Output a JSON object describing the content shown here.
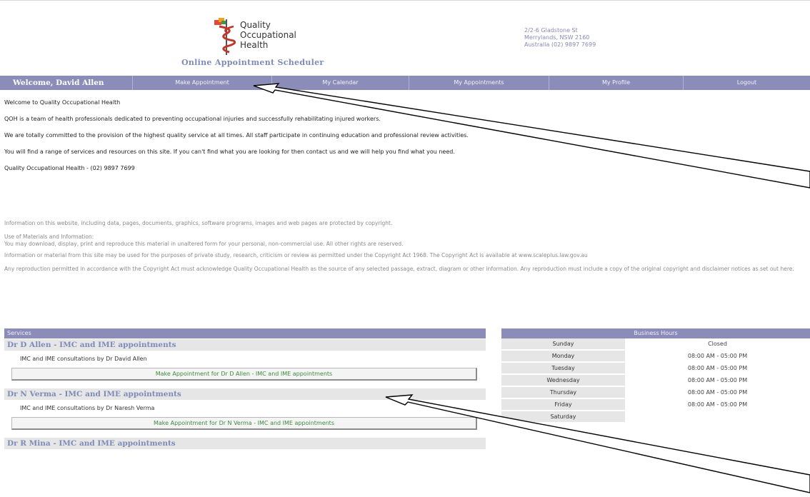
{
  "header": {
    "brand_line1": "Quality",
    "brand_line2": "Occupational",
    "brand_line3": "Health",
    "scheduler_title": "Online Appointment Scheduler",
    "address_line1": "2/2-6 Gladstone St",
    "address_line2": "Merrylands, NSW 2160",
    "address_line3": "Australia  (02) 9897 7699"
  },
  "nav": {
    "welcome": "Welcome, David Allen",
    "items": [
      "Make Appointment",
      "My Calendar",
      "My Appointments",
      "My Profile",
      "Logout"
    ]
  },
  "intro": [
    "Welcome to Quality Occupational Health",
    "QOH is a team of health professionals dedicated to preventing occupational injuries and successfully rehabilitating injured workers.",
    "We are totally committed to the provision of the highest quality service at all times. All staff participate in continuing education and professional review activities.",
    "You will find a range of services and resources on this site. If you can't find what you are looking for then contact us and we will help you find what you need.",
    "Quality Occupational Health - (02) 9897 7699"
  ],
  "legal": [
    "Information on this website, including data, pages, documents, graphics, software programs, images and web pages are protected by copyright.",
    "Use of Materials and Information:",
    "You may download, display, print and reproduce this material in unaltered form for your personal, non-commercial use. All other rights are reserved.",
    "Information or material from this site may be used for the purposes of private study, research, criticism or review as permitted under the Copyright Act 1968. The Copyright Act is available at www.scaleplus.law.gov.au",
    "Any reproduction permitted in accordance with the Copyright Act must acknowledge Quality Occupational Health as the source of any selected passage, extract, diagram or other information. Any reproduction must include a copy of the original copyright and disclaimer notices as set out here."
  ],
  "services": {
    "heading": "Services",
    "items": [
      {
        "title": "Dr D Allen - IMC and IME appointments",
        "desc": "IMC and IME consultations by Dr David Allen",
        "button": "Make Appointment for Dr D Allen - IMC and IME appointments"
      },
      {
        "title": "Dr N Verma - IMC and IME appointments",
        "desc": "IMC and IME consultations by Dr Naresh Verma",
        "button": "Make Appointment for Dr N Verma - IMC and IME appointments"
      },
      {
        "title": "Dr R Mina - IMC and IME appointments"
      }
    ]
  },
  "hours": {
    "heading": "Business Hours",
    "rows": [
      {
        "day": "Sunday",
        "time": "Closed"
      },
      {
        "day": "Monday",
        "time": "08:00 AM - 05:00 PM"
      },
      {
        "day": "Tuesday",
        "time": "08:00 AM - 05:00 PM"
      },
      {
        "day": "Wednesday",
        "time": "08:00 AM - 05:00 PM"
      },
      {
        "day": "Thursday",
        "time": "08:00 AM - 05:00 PM"
      },
      {
        "day": "Friday",
        "time": "08:00 AM - 05:00 PM"
      },
      {
        "day": "Saturday",
        "time": ""
      }
    ]
  },
  "colors": {
    "nav_bg": "#8c8cb8",
    "accent_title": "#7e8bb8",
    "button_text": "#3e8a3e"
  }
}
